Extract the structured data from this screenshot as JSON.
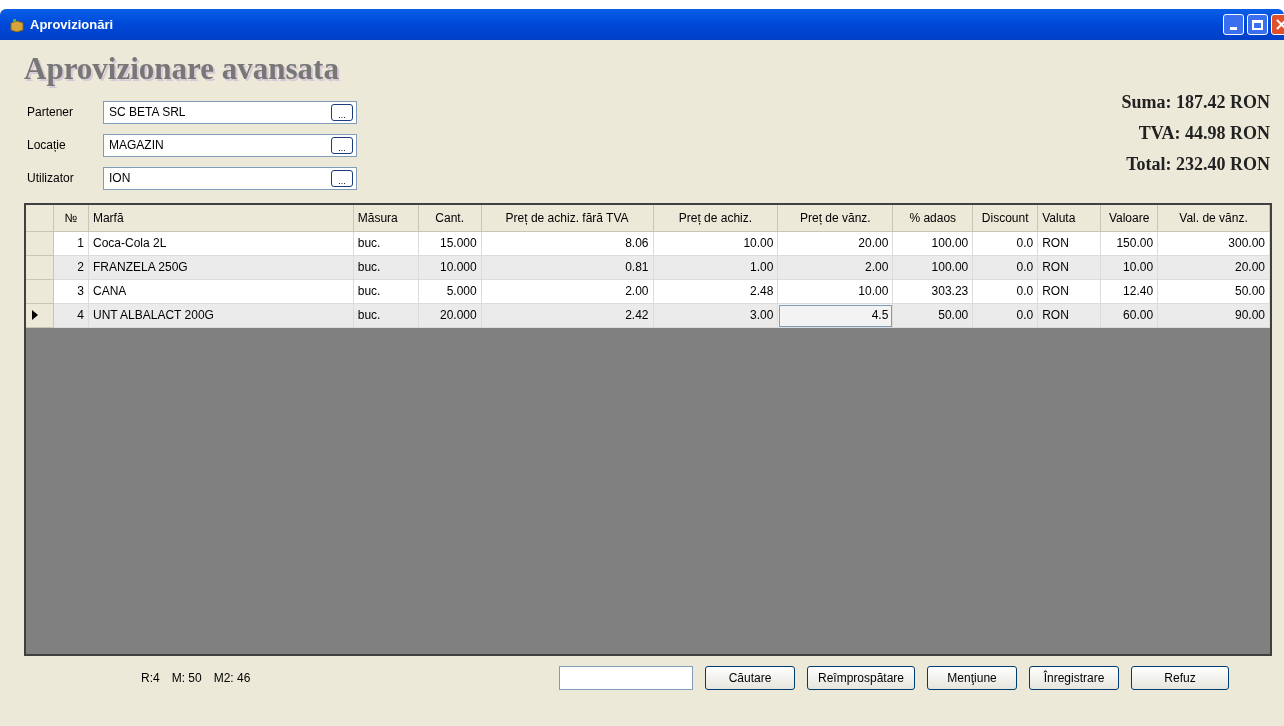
{
  "window": {
    "title": "Aprovizionări"
  },
  "heading": "Aprovizionare avansata",
  "fields": [
    {
      "label": "Partener",
      "value": "SC BETA SRL",
      "button": "..."
    },
    {
      "label": "Locație",
      "value": "MAGAZIN",
      "button": "..."
    },
    {
      "label": "Utilizator",
      "value": "ION",
      "button": "..."
    }
  ],
  "totals": [
    "Suma: 187.42 RON",
    "TVA: 44.98 RON",
    "Total: 232.40 RON"
  ],
  "table": {
    "columns": [
      {
        "label": "№",
        "kind": "number"
      },
      {
        "label": "Marfă",
        "kind": "text"
      },
      {
        "label": "Măsura",
        "kind": "text"
      },
      {
        "label": "Cant.",
        "kind": "number"
      },
      {
        "label": "Preț de achiz. fără TVA",
        "kind": "number"
      },
      {
        "label": "Preț de achiz.",
        "kind": "number"
      },
      {
        "label": "Preț de vănz.",
        "kind": "number"
      },
      {
        "label": "% adaos",
        "kind": "number"
      },
      {
        "label": "Discount",
        "kind": "number"
      },
      {
        "label": "Valuta",
        "kind": "text"
      },
      {
        "label": "Valoare",
        "kind": "number"
      },
      {
        "label": "Val. de vănz.",
        "kind": "number"
      }
    ],
    "rows": [
      {
        "selected": false,
        "cells": [
          "1",
          "Coca-Cola 2L",
          "buc.",
          "15.000",
          "8.06",
          "10.00",
          "20.00",
          "100.00",
          "0.0",
          "RON",
          "150.00",
          "300.00"
        ]
      },
      {
        "selected": false,
        "cells": [
          "2",
          "FRANZELA 250G",
          "buc.",
          "10.000",
          "0.81",
          "1.00",
          "2.00",
          "100.00",
          "0.0",
          "RON",
          "10.00",
          "20.00"
        ]
      },
      {
        "selected": false,
        "cells": [
          "3",
          "CANA",
          "buc.",
          "5.000",
          "2.00",
          "2.48",
          "10.00",
          "303.23",
          "0.0",
          "RON",
          "12.40",
          "50.00"
        ]
      },
      {
        "selected": true,
        "cells": [
          "4",
          "UNT ALBALACT 200G",
          "buc.",
          "20.000",
          "2.42",
          "3.00",
          {
            "value": "4.5",
            "editing": true
          },
          "50.00",
          "0.0",
          "RON",
          "60.00",
          "90.00"
        ]
      }
    ]
  },
  "status": [
    "R:4",
    "M: 50",
    "M2: 46"
  ],
  "buttons": [
    "Căutare",
    "Reîmprospătare",
    "Menţiune",
    "Înregistrare",
    "Refuz"
  ]
}
